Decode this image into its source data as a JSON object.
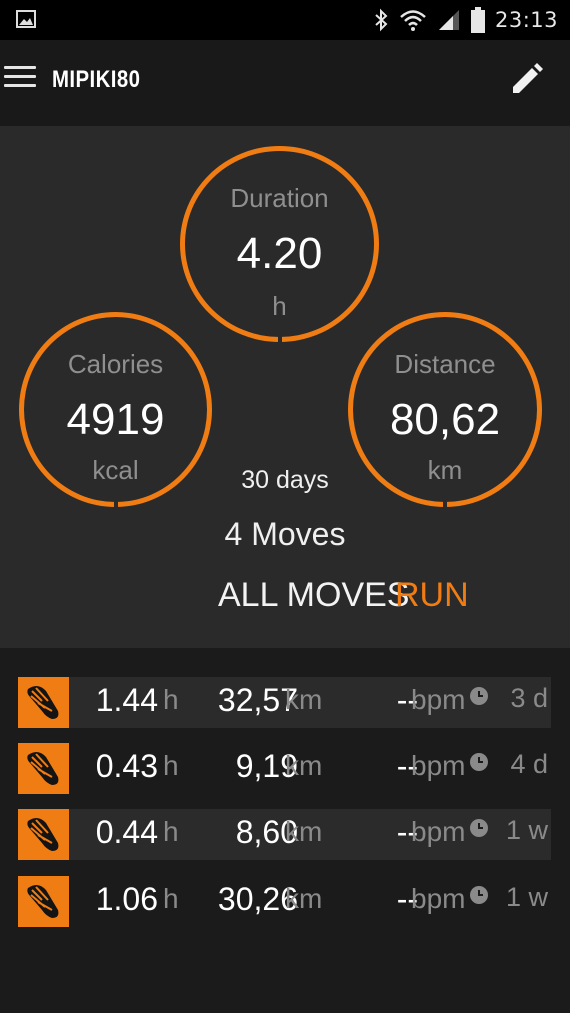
{
  "status_bar": {
    "time": "23:13",
    "icons": [
      "image-icon",
      "bluetooth-icon",
      "wifi-icon",
      "signal-icon",
      "battery-icon"
    ]
  },
  "app_bar": {
    "title": "MIPIKI80",
    "icons": [
      "menu-icon",
      "edit-pencil-icon"
    ]
  },
  "summary": {
    "duration": {
      "label": "Duration",
      "value": "4.20",
      "unit": "h"
    },
    "calories": {
      "label": "Calories",
      "value": "4919",
      "unit": "kcal"
    },
    "distance": {
      "label": "Distance",
      "value": "80,62",
      "unit": "km"
    },
    "period": "30 days",
    "moves_count": "4 Moves",
    "filters": {
      "all": "ALL MOVES",
      "active": "RUN"
    }
  },
  "moves": [
    {
      "duration": "1.44",
      "duration_unit": "h",
      "distance": "32,57",
      "distance_unit": "km",
      "hr": "--",
      "hr_unit": "bpm",
      "ago": "3 d"
    },
    {
      "duration": "0.43",
      "duration_unit": "h",
      "distance": "9,19",
      "distance_unit": "km",
      "hr": "--",
      "hr_unit": "bpm",
      "ago": "4 d"
    },
    {
      "duration": "0.44",
      "duration_unit": "h",
      "distance": "8,60",
      "distance_unit": "km",
      "hr": "--",
      "hr_unit": "bpm",
      "ago": "1 w"
    },
    {
      "duration": "1.06",
      "duration_unit": "h",
      "distance": "30,26",
      "distance_unit": "km",
      "hr": "--",
      "hr_unit": "bpm",
      "ago": "1 w"
    }
  ],
  "colors": {
    "accent": "#f07c14",
    "background": "#1b1b1b",
    "panel": "#2a2a2a",
    "muted_text": "#8a8a8a"
  }
}
